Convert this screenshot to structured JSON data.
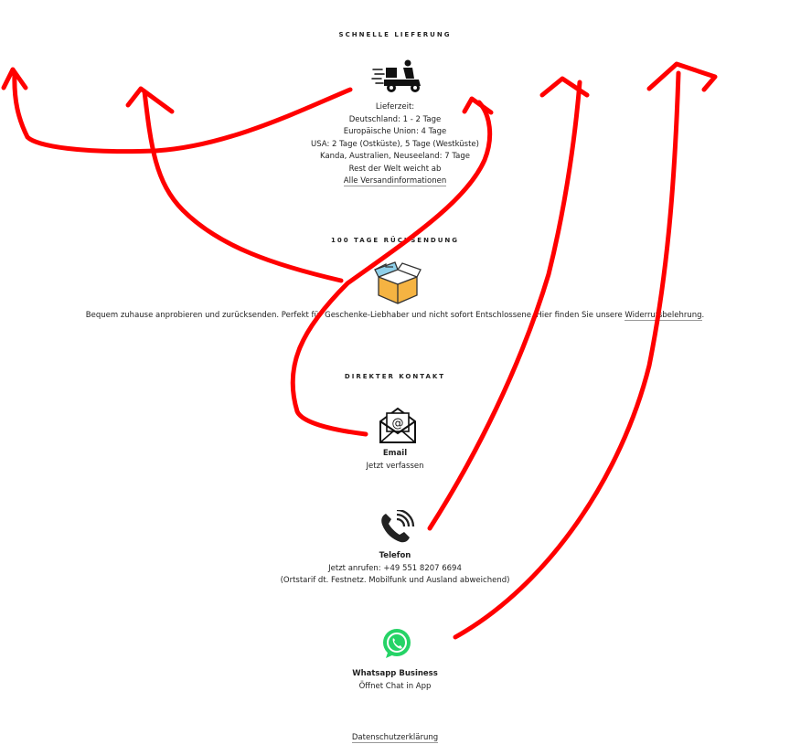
{
  "delivery": {
    "heading": "SCHNELLE LIEFERUNG",
    "lines": [
      "Lieferzeit:",
      "Deutschland: 1 - 2 Tage",
      "Europäische Union: 4 Tage",
      "USA: 2 Tage (Ostküste), 5 Tage (Westküste)",
      "Kanda, Australien, Neuseeland: 7 Tage",
      "Rest der Welt weicht ab"
    ],
    "link": "Alle Versandinformationen",
    "icon": "scooter-delivery-icon"
  },
  "returns": {
    "heading": "100 TAGE RÜCKSENDUNG",
    "text": "Bequem zuhause anprobieren und zurücksenden. Perfekt für Geschenke-Liebhaber und nicht sofort Entschlossene. Hier finden Sie unsere ",
    "link": "Widerrufsbelehrung",
    "text_end": ".",
    "icon": "return-box-icon"
  },
  "contact": {
    "heading": "DIREKTER KONTAKT",
    "email": {
      "title": "Email",
      "sub": "Jetzt verfassen",
      "icon": "envelope-icon"
    },
    "phone": {
      "title": "Telefon",
      "sub": "Jetzt anrufen: +49 551 8207 6694",
      "note": "(Ortstarif dt. Festnetz. Mobilfunk und Ausland abweichend)",
      "icon": "phone-icon"
    },
    "whatsapp": {
      "title": "Whatsapp Business",
      "sub": "Öffnet Chat in App",
      "icon": "whatsapp-icon"
    }
  },
  "footer": {
    "privacy": "Datenschutzerklärung"
  },
  "colors": {
    "annotation": "#ff0000",
    "whatsapp": "#25d366",
    "box": "#f5b342",
    "box_flap": "#8fd0ea"
  }
}
